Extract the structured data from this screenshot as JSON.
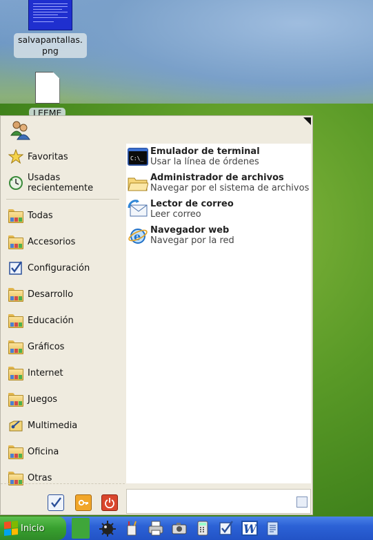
{
  "desktop": {
    "icons": [
      {
        "label": "salvapantallas.\npng"
      },
      {
        "label": "LEEME"
      }
    ]
  },
  "menu": {
    "categories": [
      {
        "label": "Favoritas",
        "icon": "star-icon"
      },
      {
        "label": "Usadas recientemente",
        "icon": "recent-icon"
      },
      {
        "label": "Todas",
        "icon": "folder-icon"
      },
      {
        "label": "Accesorios",
        "icon": "folder-icon"
      },
      {
        "label": "Configuración",
        "icon": "settings-icon"
      },
      {
        "label": "Desarrollo",
        "icon": "folder-icon"
      },
      {
        "label": "Educación",
        "icon": "folder-icon"
      },
      {
        "label": "Gráficos",
        "icon": "folder-icon"
      },
      {
        "label": "Internet",
        "icon": "folder-icon"
      },
      {
        "label": "Juegos",
        "icon": "folder-icon"
      },
      {
        "label": "Multimedia",
        "icon": "multimedia-icon"
      },
      {
        "label": "Oficina",
        "icon": "folder-icon"
      },
      {
        "label": "Otras",
        "icon": "folder-icon"
      }
    ],
    "apps": [
      {
        "title": "Emulador de terminal",
        "subtitle": "Usar la línea de órdenes",
        "icon": "terminal-icon"
      },
      {
        "title": "Administrador de archivos",
        "subtitle": "Navegar por el sistema de archivos",
        "icon": "file-manager-icon"
      },
      {
        "title": "Lector de correo",
        "subtitle": "Leer correo",
        "icon": "mail-icon"
      },
      {
        "title": "Navegador web",
        "subtitle": "Navegar por la red",
        "icon": "web-browser-icon"
      }
    ],
    "search": {
      "value": "",
      "placeholder": ""
    },
    "bottom_buttons": [
      "settings-icon",
      "lock-icon",
      "logout-icon"
    ]
  },
  "taskbar": {
    "start_label": "Inicio"
  },
  "colors": {
    "taskbar": "#2c62d6",
    "start_button": "#38a02f",
    "menu_bg": "#efebdf"
  }
}
